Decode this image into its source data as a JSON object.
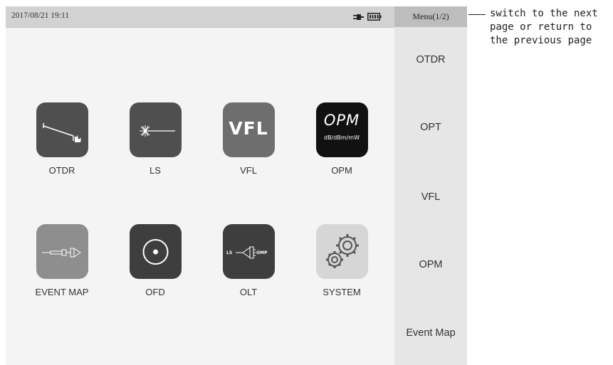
{
  "status_bar": {
    "datetime": "2017/08/21 19:11",
    "icons": [
      "plug-icon",
      "battery-icon"
    ]
  },
  "menu": {
    "header": "Menu(1/2)",
    "items": [
      "OTDR",
      "OPT",
      "VFL",
      "OPM",
      "Event Map"
    ]
  },
  "apps": [
    {
      "label": "OTDR",
      "icon": "otdr-trace-icon"
    },
    {
      "label": "LS",
      "icon": "laser-source-icon"
    },
    {
      "label": "VFL",
      "icon": "vfl-logo-icon",
      "tile_text": "VFL"
    },
    {
      "label": "OPM",
      "icon": "opm-logo-icon",
      "tile_text": "OPM",
      "tile_subtext": "dB/dBm/mW"
    },
    {
      "label": "EVENT MAP",
      "icon": "fiber-connector-icon"
    },
    {
      "label": "OFD",
      "icon": "target-circle-icon"
    },
    {
      "label": "OLT",
      "icon": "loss-test-icon",
      "tile_left": "LS",
      "tile_right": "OMP"
    },
    {
      "label": "SYSTEM",
      "icon": "gears-icon"
    }
  ],
  "annotation": "switch to the next page or return to the previous page",
  "colors": {
    "status_bar": "#d2d2d2",
    "menu_panel": "#e6e6e6",
    "menu_header": "#bdbdbd",
    "screen": "#f4f4f4"
  }
}
